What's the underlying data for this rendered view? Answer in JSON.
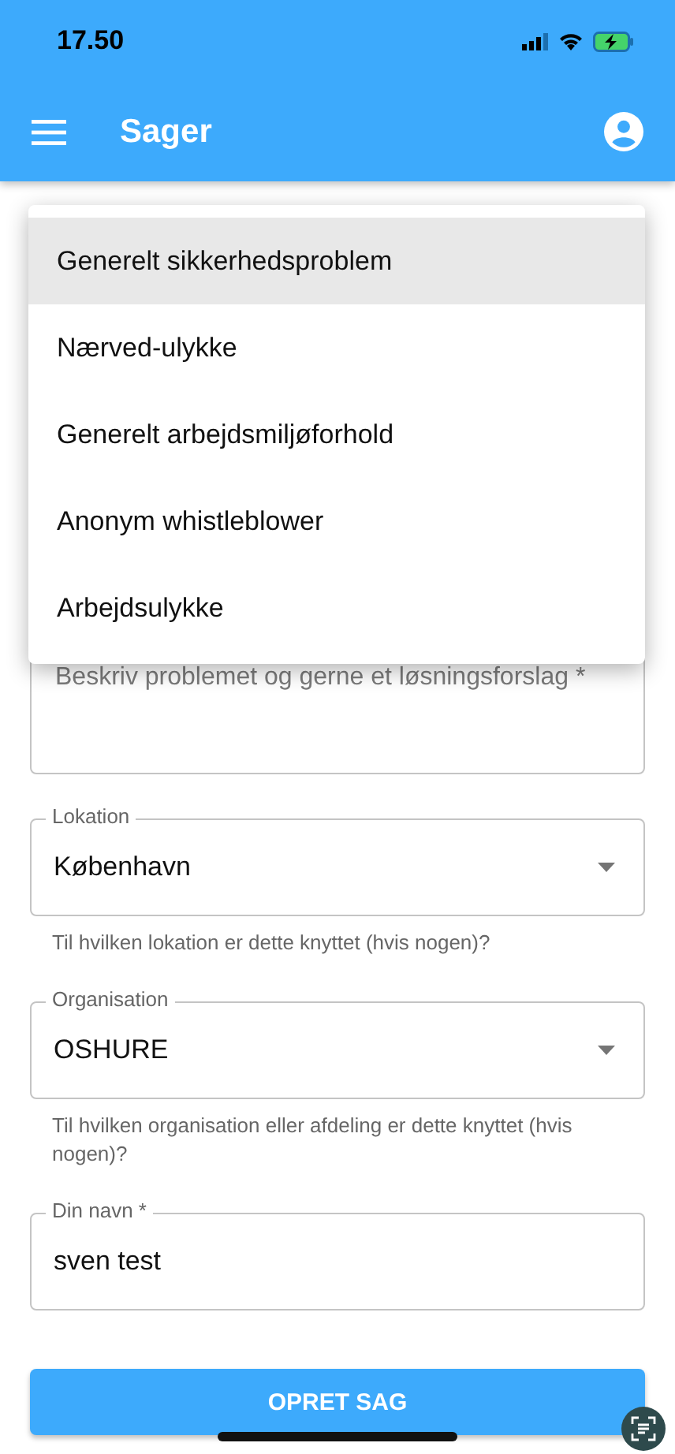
{
  "status_bar": {
    "time": "17.50"
  },
  "app_bar": {
    "title": "Sager"
  },
  "dropdown_menu": {
    "items": [
      {
        "label": "Generelt sikkerhedsproblem",
        "selected": true
      },
      {
        "label": "Nærved-ulykke",
        "selected": false
      },
      {
        "label": "Generelt arbejdsmiljøforhold",
        "selected": false
      },
      {
        "label": "Anonym whistleblower",
        "selected": false
      },
      {
        "label": "Arbejdsulykke",
        "selected": false
      }
    ]
  },
  "fields": [
    {
      "kind": "textarea",
      "placeholder": "Beskriv problemet og gerne et løsningsforslag *"
    },
    {
      "kind": "select",
      "label": "Lokation",
      "value": "København",
      "helper": "Til hvilken lokation er dette knyttet (hvis nogen)?"
    },
    {
      "kind": "select",
      "label": "Organisation",
      "value": "OSHURE",
      "helper": "Til hvilken organisation eller afdeling er dette knyttet (hvis nogen)?"
    },
    {
      "kind": "text",
      "label": "Din navn *",
      "value": "sven test"
    }
  ],
  "submit_button": {
    "label": "OPRET SAG"
  }
}
